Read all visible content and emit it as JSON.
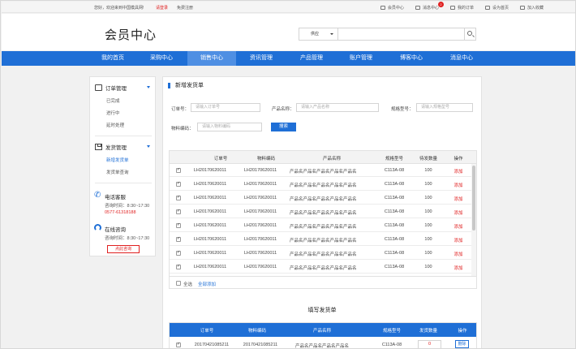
{
  "topbar": {
    "welcome": "您好，欢迎来到中国模具网!",
    "login": "请登录",
    "register": "免费注册",
    "links": [
      {
        "label": "会员中心",
        "icon": "user-icon"
      },
      {
        "label": "消息中心",
        "icon": "mail-icon",
        "badge": "2"
      },
      {
        "label": "我的订单",
        "icon": "cart-icon"
      },
      {
        "label": "设为首页",
        "icon": "home-icon"
      },
      {
        "label": "加入收藏",
        "icon": "star-icon"
      }
    ]
  },
  "header": {
    "logo": "会员中心",
    "search_type": "供应",
    "search_placeholder": ""
  },
  "nav": {
    "items": [
      "我的首页",
      "采购中心",
      "销售中心",
      "资讯管理",
      "产品管理",
      "账户管理",
      "博客中心",
      "消息中心"
    ],
    "active_index": 2
  },
  "sidebar": {
    "order": {
      "title": "订单管理",
      "items": [
        "已完成",
        "进行中",
        "延时处理"
      ]
    },
    "shipping": {
      "title": "发货管理",
      "items": [
        "新增发货单",
        "发货单查询"
      ],
      "active": "新增发货单"
    },
    "phone": {
      "title": "电话客服",
      "hours": "咨询时间：8:30~17:30",
      "number": "0577-61318188"
    },
    "online": {
      "title": "在线咨询",
      "hours": "咨询时间：8:30~17:30",
      "button": "点此咨询"
    }
  },
  "main": {
    "title": "新增发货单",
    "form": {
      "order_no_label": "订单号：",
      "order_no_placeholder": "请输入订单号",
      "product_label": "产品名称：",
      "product_placeholder": "请输入产品名称",
      "spec_label": "规格型号：",
      "spec_placeholder": "请输入规格型号",
      "material_label": "物料编码：",
      "material_placeholder": "请输入物料编码",
      "search_button": "搜索"
    },
    "table": {
      "headers": [
        "订单号",
        "物料编码",
        "产品名称",
        "规格型号",
        "待发数量",
        "操作"
      ],
      "rows": [
        {
          "order": "LH20170620011",
          "material": "LH20170620011",
          "product": "产品名产品名产品名产品名产品名",
          "spec": "C113A-08",
          "qty": "100",
          "action": "添加"
        },
        {
          "order": "LH20170620011",
          "material": "LH20170620011",
          "product": "产品名产品名产品名产品名产品名",
          "spec": "C113A-08",
          "qty": "100",
          "action": "添加"
        },
        {
          "order": "LH20170620011",
          "material": "LH20170620011",
          "product": "产品名产品名产品名产品名产品名",
          "spec": "C113A-08",
          "qty": "100",
          "action": "添加"
        },
        {
          "order": "LH20170620011",
          "material": "LH20170620011",
          "product": "产品名产品名产品名产品名产品名",
          "spec": "C113A-08",
          "qty": "100",
          "action": "添加"
        },
        {
          "order": "LH20170620011",
          "material": "LH20170620011",
          "product": "产品名产品名产品名产品名产品名",
          "spec": "C113A-08",
          "qty": "100",
          "action": "添加"
        },
        {
          "order": "LH20170620011",
          "material": "LH20170620011",
          "product": "产品名产品名产品名产品名产品名",
          "spec": "C113A-08",
          "qty": "100",
          "action": "添加"
        },
        {
          "order": "LH20170620011",
          "material": "LH20170620011",
          "product": "产品名产品名产品名产品名产品名",
          "spec": "C113A-08",
          "qty": "100",
          "action": "添加"
        },
        {
          "order": "LH20170620011",
          "material": "LH20170620011",
          "product": "产品名产品名产品名产品名产品名",
          "spec": "C113A-08",
          "qty": "100",
          "action": "添加"
        }
      ],
      "select_all": "全选",
      "add_all": "全部添加"
    },
    "fill": {
      "title": "填写发货单",
      "headers": [
        "订单号",
        "物料编码",
        "产品名称",
        "规格型号",
        "发货数量",
        "操作"
      ],
      "rows": [
        {
          "order": "20170421085211",
          "material": "20170421085211",
          "product": "产品名产品名产品名产品名",
          "spec": "C113A-08",
          "qty": "0",
          "action": "删除"
        }
      ]
    }
  }
}
